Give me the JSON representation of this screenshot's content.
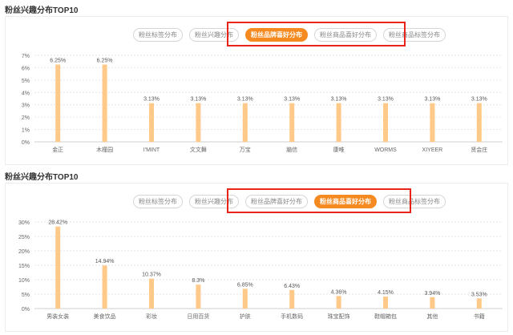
{
  "colors": {
    "accent": "#f58a20",
    "bar": "#ffc98a",
    "highlight": "#e8231a",
    "grid": "#e6e6e6"
  },
  "sections": [
    {
      "title": "粉丝兴趣分布TOP10",
      "tabs": [
        {
          "label": "粉丝标签分布",
          "active": false
        },
        {
          "label": "粉丝兴趣分布",
          "active": false
        },
        {
          "label": "粉丝品牌喜好分布",
          "active": true
        },
        {
          "label": "粉丝商品喜好分布",
          "active": false
        },
        {
          "label": "粉丝商品标签分布",
          "active": false
        }
      ]
    },
    {
      "title": "粉丝兴趣分布TOP10",
      "tabs": [
        {
          "label": "粉丝标签分布",
          "active": false
        },
        {
          "label": "粉丝兴趣分布",
          "active": false
        },
        {
          "label": "粉丝品牌喜好分布",
          "active": false
        },
        {
          "label": "粉丝商品喜好分布",
          "active": true
        },
        {
          "label": "粉丝商品标签分布",
          "active": false
        }
      ]
    }
  ],
  "chart_data": [
    {
      "type": "bar",
      "categories": [
        "金正",
        "木槿园",
        "I'MINT",
        "文文舞",
        "万宝",
        "脑信",
        "康唯",
        "WORMS",
        "XIYEER",
        "贤会庄"
      ],
      "values": [
        6.25,
        6.25,
        3.13,
        3.13,
        3.13,
        3.13,
        3.13,
        3.13,
        3.13,
        3.13
      ],
      "data_labels": [
        "6.25%",
        "6.25%",
        "3.13%",
        "3.13%",
        "3.13%",
        "3.13%",
        "3.13%",
        "3.13%",
        "3.13%",
        "3.13%"
      ],
      "yticks": [
        "0%",
        "1%",
        "2%",
        "3%",
        "4%",
        "5%",
        "6%",
        "7%"
      ],
      "ylim": [
        0,
        7
      ],
      "grid": true
    },
    {
      "type": "bar",
      "categories": [
        "男装女装",
        "美食饮品",
        "彩妆",
        "日用百货",
        "护肤",
        "手机数码",
        "珠宝配饰",
        "鞋帽箱包",
        "其他",
        "书籍"
      ],
      "values": [
        28.42,
        14.94,
        10.37,
        8.3,
        6.85,
        6.43,
        4.36,
        4.15,
        3.94,
        3.53
      ],
      "data_labels": [
        "28.42%",
        "14.94%",
        "10.37%",
        "8.3%",
        "6.85%",
        "6.43%",
        "4.36%",
        "4.15%",
        "3.94%",
        "3.53%"
      ],
      "yticks": [
        "0%",
        "5%",
        "10%",
        "15%",
        "20%",
        "25%",
        "30%"
      ],
      "ylim": [
        0,
        30
      ],
      "grid": true
    }
  ]
}
